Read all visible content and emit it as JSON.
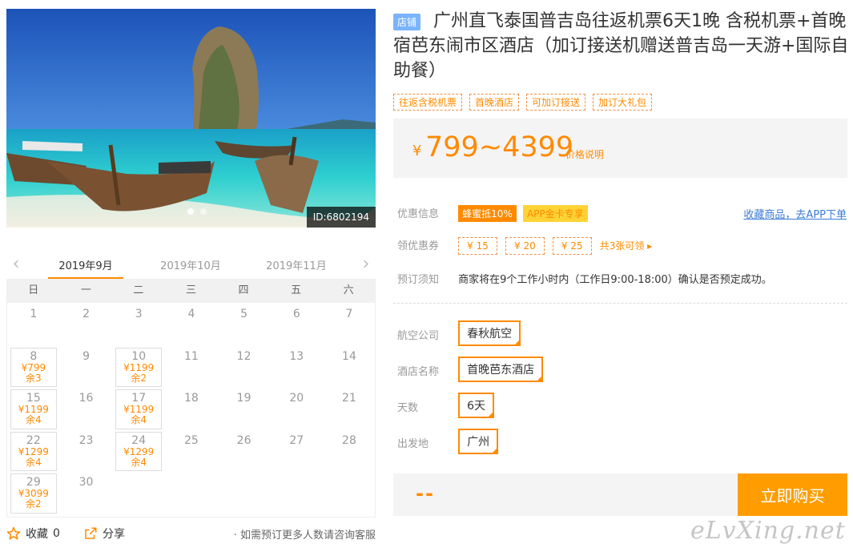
{
  "hero": {
    "id_label": "ID:6802194"
  },
  "calendar": {
    "months": [
      "2019年9月",
      "2019年10月",
      "2019年11月"
    ],
    "weekdays": [
      "日",
      "一",
      "二",
      "三",
      "四",
      "五",
      "六"
    ],
    "cells": [
      {
        "d": "1"
      },
      {
        "d": "2"
      },
      {
        "d": "3"
      },
      {
        "d": "4"
      },
      {
        "d": "5"
      },
      {
        "d": "6"
      },
      {
        "d": "7"
      },
      {
        "d": "8",
        "p": "¥799",
        "r": "余3"
      },
      {
        "d": "9"
      },
      {
        "d": "10",
        "p": "¥1199",
        "r": "余2"
      },
      {
        "d": "11"
      },
      {
        "d": "12"
      },
      {
        "d": "13"
      },
      {
        "d": "14"
      },
      {
        "d": "15",
        "p": "¥1199",
        "r": "余4"
      },
      {
        "d": "16"
      },
      {
        "d": "17",
        "p": "¥1199",
        "r": "余4"
      },
      {
        "d": "18"
      },
      {
        "d": "19"
      },
      {
        "d": "20"
      },
      {
        "d": "21"
      },
      {
        "d": "22",
        "p": "¥1299",
        "r": "余4"
      },
      {
        "d": "23"
      },
      {
        "d": "24",
        "p": "¥1299",
        "r": "余4"
      },
      {
        "d": "25"
      },
      {
        "d": "26"
      },
      {
        "d": "27"
      },
      {
        "d": "28"
      },
      {
        "d": "29",
        "p": "¥3099",
        "r": "余2"
      },
      {
        "d": "30"
      }
    ]
  },
  "footer": {
    "fav_label": "收藏",
    "fav_count": "0",
    "share_label": "分享",
    "note": "· 如需预订更多人数请咨询客服"
  },
  "product": {
    "shop_tag": "店铺",
    "title": "广州直飞泰国普吉岛往返机票6天1晚 含税机票+首晚宿芭东闹市区酒店（加订接送机赠送普吉岛一天游+国际自助餐）",
    "tags": [
      "往返含税机票",
      "首晚酒店",
      "可加订接送",
      "加订大礼包"
    ],
    "currency": "¥",
    "price_range": "799~4399",
    "price_note": "价格说明"
  },
  "discount": {
    "label": "优惠信息",
    "badges": [
      "蜂蜜抵10%",
      "APP金卡专享"
    ],
    "app_link": "收藏商品，去APP下单"
  },
  "coupons": {
    "label": "领优惠券",
    "items": [
      "¥ 15",
      "¥ 20",
      "¥ 25"
    ],
    "more": "共3张可领 ▸"
  },
  "booking": {
    "label": "预订须知",
    "text": "商家将在9个工作小时内（工作日9:00-18:00）确认是否预定成功。"
  },
  "options": [
    {
      "label": "航空公司",
      "value": "春秋航空"
    },
    {
      "label": "酒店名称",
      "value": "首晚芭东酒店"
    },
    {
      "label": "天数",
      "value": "6天"
    },
    {
      "label": "出发地",
      "value": "广州"
    }
  ],
  "buy": {
    "total_placeholder": "--",
    "button": "立即购买"
  },
  "watermark": "eLvXing.net",
  "colors": {
    "accent": "#ff8a00",
    "button": "#ff9d00",
    "link": "#3b7bd6",
    "shop_tag": "#7ab4ff"
  }
}
